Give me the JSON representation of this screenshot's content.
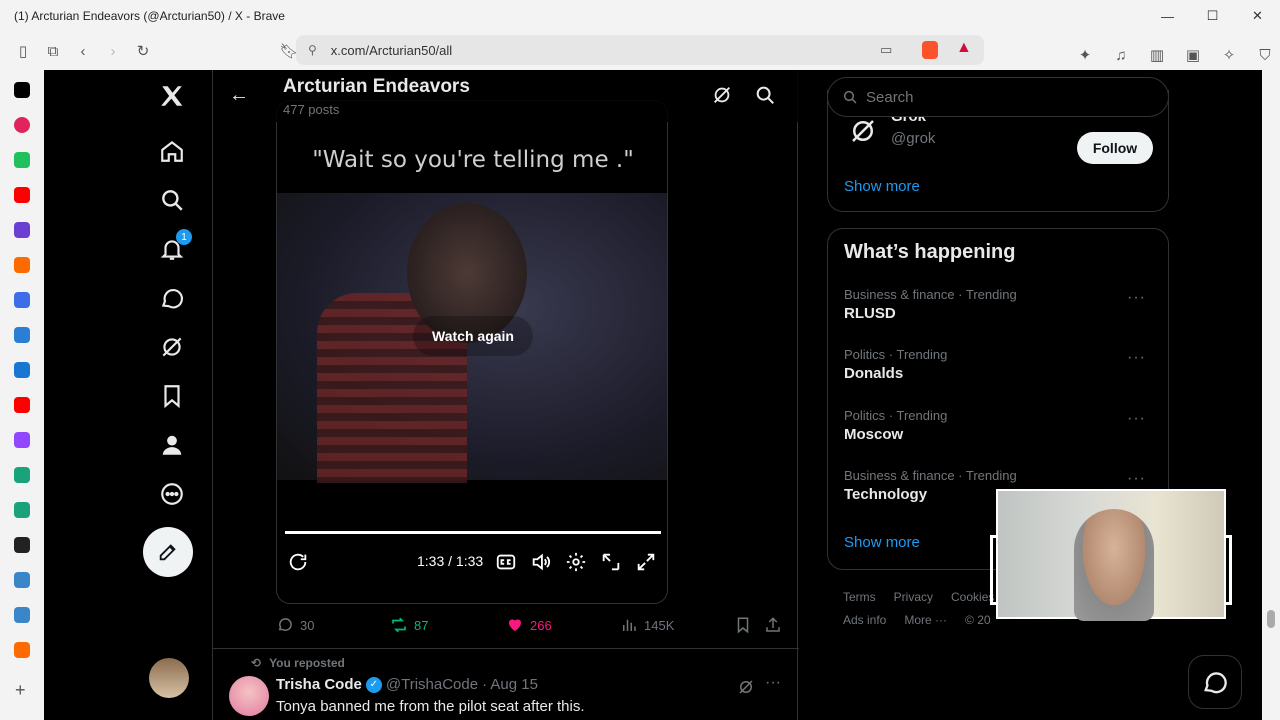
{
  "browser": {
    "window_title": "(1) Arcturian Endeavors (@Arcturian50) / X - Brave",
    "url": "x.com/Arcturian50/all"
  },
  "header": {
    "profile_name": "Arcturian Endeavors",
    "post_count": "477 posts"
  },
  "nav": {
    "notifications_badge": "1"
  },
  "video": {
    "caption": "\"Wait so you're telling me .\"",
    "watch_again": "Watch again",
    "time": "1:33 / 1:33",
    "progress": 1.0
  },
  "actions": {
    "replies": "30",
    "reposts": "87",
    "likes": "266",
    "views": "145K"
  },
  "next_tweet": {
    "repost_label": "You reposted",
    "name": "Trisha Code",
    "handle": "@TrishaCode",
    "date": "· Aug 15",
    "text": "Tonya banned me from the pilot seat after this."
  },
  "right": {
    "search_placeholder": "Search",
    "grok_name": "Grok",
    "grok_handle": "@grok",
    "follow_label": "Follow",
    "show_more_1": "Show more",
    "whats_happening": "What’s happening",
    "trends": [
      {
        "meta": "Business & finance · Trending",
        "name": "RLUSD"
      },
      {
        "meta": "Politics · Trending",
        "name": "Donalds"
      },
      {
        "meta": "Politics · Trending",
        "name": "Moscow"
      },
      {
        "meta": "Business & finance · Trending",
        "name": "Technology"
      }
    ],
    "show_more_2": "Show more",
    "footer": [
      "Terms",
      "Privacy",
      "Cookies"
    ],
    "footer2": [
      "Ads info",
      "More ···",
      "© 20"
    ]
  },
  "colors": {
    "accent": "#1d9bf0",
    "like": "#f91880",
    "repost": "#00ba7c"
  }
}
